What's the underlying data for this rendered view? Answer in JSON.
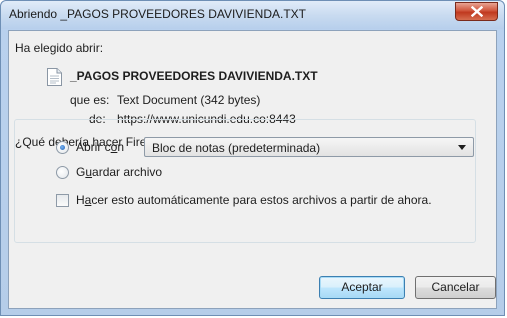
{
  "window": {
    "title": "Abriendo _PAGOS PROVEEDORES DAVIVIENDA.TXT"
  },
  "dialog": {
    "intro": "Ha elegido abrir:",
    "file_icon": "text-file-icon",
    "file_name": "_PAGOS PROVEEDORES DAVIVIENDA.TXT",
    "type_label": "que es:",
    "type_value": "Text Document (342 bytes)",
    "from_label": "de:",
    "from_value": "https://www.unicundi.edu.co:8443",
    "question": "¿Qué debería hacer Firefox con este archivo?"
  },
  "options": {
    "open_with": {
      "prefix": "Abrir c",
      "accel": "o",
      "suffix": "n",
      "checked": true
    },
    "open_with_app": "Bloc de notas (predeterminada)",
    "save_file": {
      "prefix": "G",
      "accel": "u",
      "suffix": "ardar archivo",
      "checked": false
    },
    "auto": {
      "prefix": "H",
      "accel": "a",
      "suffix": "cer esto automáticamente para estos archivos a partir de ahora.",
      "checked": false
    }
  },
  "buttons": {
    "accept": "Aceptar",
    "cancel": "Cancelar"
  }
}
